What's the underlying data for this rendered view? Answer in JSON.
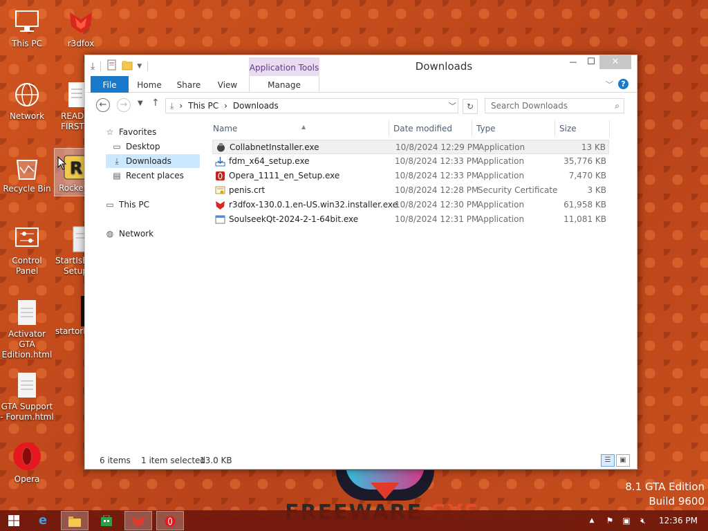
{
  "desktop": {
    "icons": [
      {
        "label": "This PC",
        "icon": "this-pc-icon"
      },
      {
        "label": "r3dfox",
        "icon": "r3dfox-icon"
      },
      {
        "label": "Network",
        "icon": "network-icon"
      },
      {
        "label": "READ",
        "label2": "FIRST",
        "icon": "text-file-icon"
      },
      {
        "label": "Recycle Bin",
        "icon": "recycle-bin-icon"
      },
      {
        "label": "Rocket",
        "icon": "rocket-icon"
      },
      {
        "label": "Control Panel",
        "icon": "control-panel-icon"
      },
      {
        "label": "StartIsBa",
        "label2": "Setup",
        "icon": "setup-icon"
      },
      {
        "label": "Activator GTA",
        "label2": "Edition.html",
        "icon": "html-file-icon"
      },
      {
        "label": "startorb",
        "icon": "image-file-icon"
      },
      {
        "label": "GTA Support",
        "label2": "- Forum.html",
        "icon": "html-file-icon"
      },
      {
        "label": "Opera",
        "icon": "opera-icon"
      }
    ],
    "edition_line1": "8.1 GTA Edition",
    "edition_line2": "Build 9600",
    "watermark_a": "FREEWARE",
    "watermark_b": "SYS"
  },
  "window": {
    "title": "Downloads",
    "context_tab": "Application Tools",
    "controls": {
      "minimize": "—",
      "maximize": "☐",
      "close": "✕"
    },
    "ribbon_tabs": [
      "File",
      "Home",
      "Share",
      "View",
      "Manage"
    ],
    "address": {
      "segments": [
        "This PC",
        "Downloads"
      ],
      "separator": "›"
    },
    "search_placeholder": "Search Downloads",
    "nav_pane": {
      "favorites": "Favorites",
      "desktop": "Desktop",
      "downloads": "Downloads",
      "recent": "Recent places",
      "this_pc": "This PC",
      "network": "Network"
    },
    "columns": {
      "name": "Name",
      "date": "Date modified",
      "type": "Type",
      "size": "Size"
    },
    "files": [
      {
        "name": "CollabnetInstaller.exe",
        "date": "10/8/2024 12:29 PM",
        "type": "Application",
        "size": "13 KB",
        "icon": "installer-icon"
      },
      {
        "name": "fdm_x64_setup.exe",
        "date": "10/8/2024 12:33 PM",
        "type": "Application",
        "size": "35,776 KB",
        "icon": "download-manager-icon"
      },
      {
        "name": "Opera_1111_en_Setup.exe",
        "date": "10/8/2024 12:33 PM",
        "type": "Application",
        "size": "7,470 KB",
        "icon": "opera-setup-icon"
      },
      {
        "name": "penis.crt",
        "date": "10/8/2024 12:28 PM",
        "type": "Security Certificate",
        "size": "3 KB",
        "icon": "certificate-icon"
      },
      {
        "name": "r3dfox-130.0.1.en-US.win32.installer.exe",
        "date": "10/8/2024 12:30 PM",
        "type": "Application",
        "size": "61,958 KB",
        "icon": "r3dfox-installer-icon"
      },
      {
        "name": "SoulseekQt-2024-2-1-64bit.exe",
        "date": "10/8/2024 12:31 PM",
        "type": "Application",
        "size": "11,081 KB",
        "icon": "soulseek-icon"
      }
    ],
    "status": {
      "items": "6 items",
      "selected": "1 item selected",
      "size": "13.0 KB"
    }
  },
  "taskbar": {
    "clock": "12:36 PM",
    "items": [
      "start",
      "internet-explorer",
      "file-explorer",
      "store",
      "r3dfox",
      "opera"
    ]
  }
}
